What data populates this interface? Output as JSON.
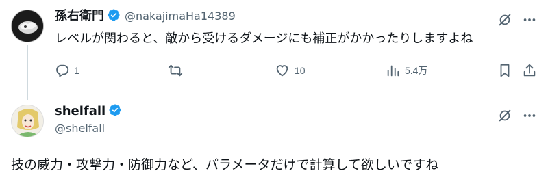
{
  "tweet1": {
    "display_name": "孫右衛門",
    "handle": "@nakajimaHa14389",
    "text": "レベルが関わると、敵から受けるダメージにも補正がかかったりしますよね",
    "actions": {
      "reply_count": "1",
      "repost_count": "",
      "like_count": "10",
      "view_count": "5.4万"
    }
  },
  "tweet2": {
    "display_name": "shelfall",
    "handle": "@shelfall",
    "text": "技の威力・攻撃力・防御力など、パラメータだけで計算して欲しいですね"
  },
  "colors": {
    "verified": "#1d9bf0",
    "secondary_text": "#536471",
    "primary_text": "#0f1419",
    "thread_line": "#cfd9de"
  },
  "icons": [
    "verified-badge-icon",
    "grok-icon",
    "more-icon",
    "reply-icon",
    "repost-icon",
    "like-icon",
    "views-icon",
    "bookmark-icon",
    "share-icon"
  ]
}
